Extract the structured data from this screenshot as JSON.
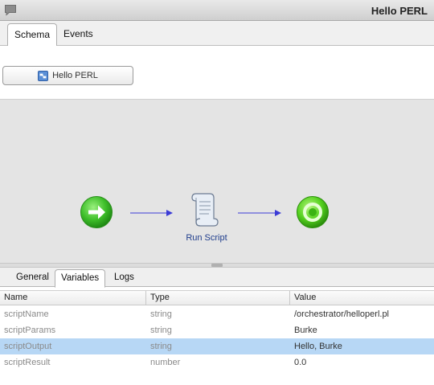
{
  "window": {
    "title": "Hello PERL"
  },
  "top_tabs": [
    {
      "label": "Schema",
      "active": true
    },
    {
      "label": "Events",
      "active": false
    }
  ],
  "workflow_button": {
    "label": "Hello PERL"
  },
  "schema": {
    "nodes": [
      {
        "kind": "start",
        "icon": "green-arrow-icon",
        "label": ""
      },
      {
        "kind": "task",
        "icon": "script-scroll-icon",
        "label": "Run Script"
      },
      {
        "kind": "end",
        "icon": "green-end-icon",
        "label": ""
      }
    ]
  },
  "bottom_tabs": [
    {
      "label": "General",
      "active": false
    },
    {
      "label": "Variables",
      "active": true
    },
    {
      "label": "Logs",
      "active": false
    }
  ],
  "variables": {
    "columns": [
      "Name",
      "Type",
      "Value"
    ],
    "rows": [
      {
        "name": "scriptName",
        "type": "string",
        "value": "/orchestrator/helloperl.pl",
        "selected": false
      },
      {
        "name": "scriptParams",
        "type": "string",
        "value": "Burke",
        "selected": false
      },
      {
        "name": "scriptOutput",
        "type": "string",
        "value": "Hello, Burke",
        "selected": true
      },
      {
        "name": "scriptResult",
        "type": "number",
        "value": "0.0",
        "selected": false
      }
    ]
  },
  "colors": {
    "selection": "#b7d7f5",
    "node_green": "#3fbf2a",
    "arrow_blue": "#3b3bd6",
    "label_blue": "#1f3d8c"
  }
}
